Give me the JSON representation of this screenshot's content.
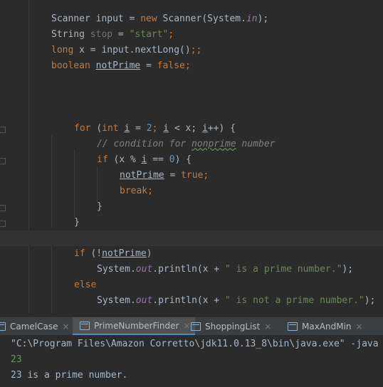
{
  "editor": {
    "lines": {
      "l1": {
        "a": "Scanner input = ",
        "b": "new ",
        "c": "Scanner(System.",
        "d": "in",
        "e": ");"
      },
      "l2": {
        "a": "String ",
        "b": "stop",
        "c": " = ",
        "d": "\"start\"",
        "e": ";"
      },
      "l3": {
        "a": "long ",
        "b": "x = input.nextLong()",
        "c": ";;"
      },
      "l4": {
        "a": "boolean ",
        "b": "notPrime",
        "c": " = ",
        "d": "false",
        "e": ";"
      },
      "l5": {
        "a": "for ",
        "b": "(",
        "c": "int ",
        "d": "i",
        "e": " = ",
        "f": "2",
        "g": "; ",
        "h": "i",
        "i2": " < x; ",
        "j": "i",
        "k": "++) {"
      },
      "l6": {
        "a": "// condition for ",
        "b": "nonprime",
        "c": " number"
      },
      "l7": {
        "a": "if ",
        "b": "(x % ",
        "c": "i",
        "d": " == ",
        "e": "0",
        "f": ") {"
      },
      "l8": {
        "a": "notPrime",
        "b": " = ",
        "c": "true",
        "d": ";"
      },
      "l9": {
        "a": "break",
        "b": ";"
      },
      "l10": {
        "a": "}"
      },
      "l11": {
        "a": "}"
      },
      "l12": {
        "a": "if ",
        "b": "(!",
        "c": "notPrime",
        "d": ")"
      },
      "l13": {
        "a": "System.",
        "b": "out",
        "c": ".println(x + ",
        "d": "\" is a prime number.\"",
        "e": ");"
      },
      "l14": {
        "a": "else"
      },
      "l15": {
        "a": "System.",
        "b": "out",
        "c": ".println(x + ",
        "d": "\" is not a prime number.\"",
        "e": ");"
      }
    }
  },
  "tabs": [
    {
      "label": "CamelCase"
    },
    {
      "label": "PrimeNumberFinder"
    },
    {
      "label": "ShoppingList"
    },
    {
      "label": "MaxAndMin"
    }
  ],
  "tab_close": "×",
  "console": {
    "command": "\"C:\\Program Files\\Amazon Corretto\\jdk11.0.13_8\\bin\\java.exe\" -java",
    "input": "23",
    "output": "23 is a prime number."
  },
  "colors": {
    "background": "#2b2b2b",
    "keyword": "#cc7832",
    "string": "#6a8759",
    "number": "#6897bb",
    "input_green": "#629755"
  }
}
